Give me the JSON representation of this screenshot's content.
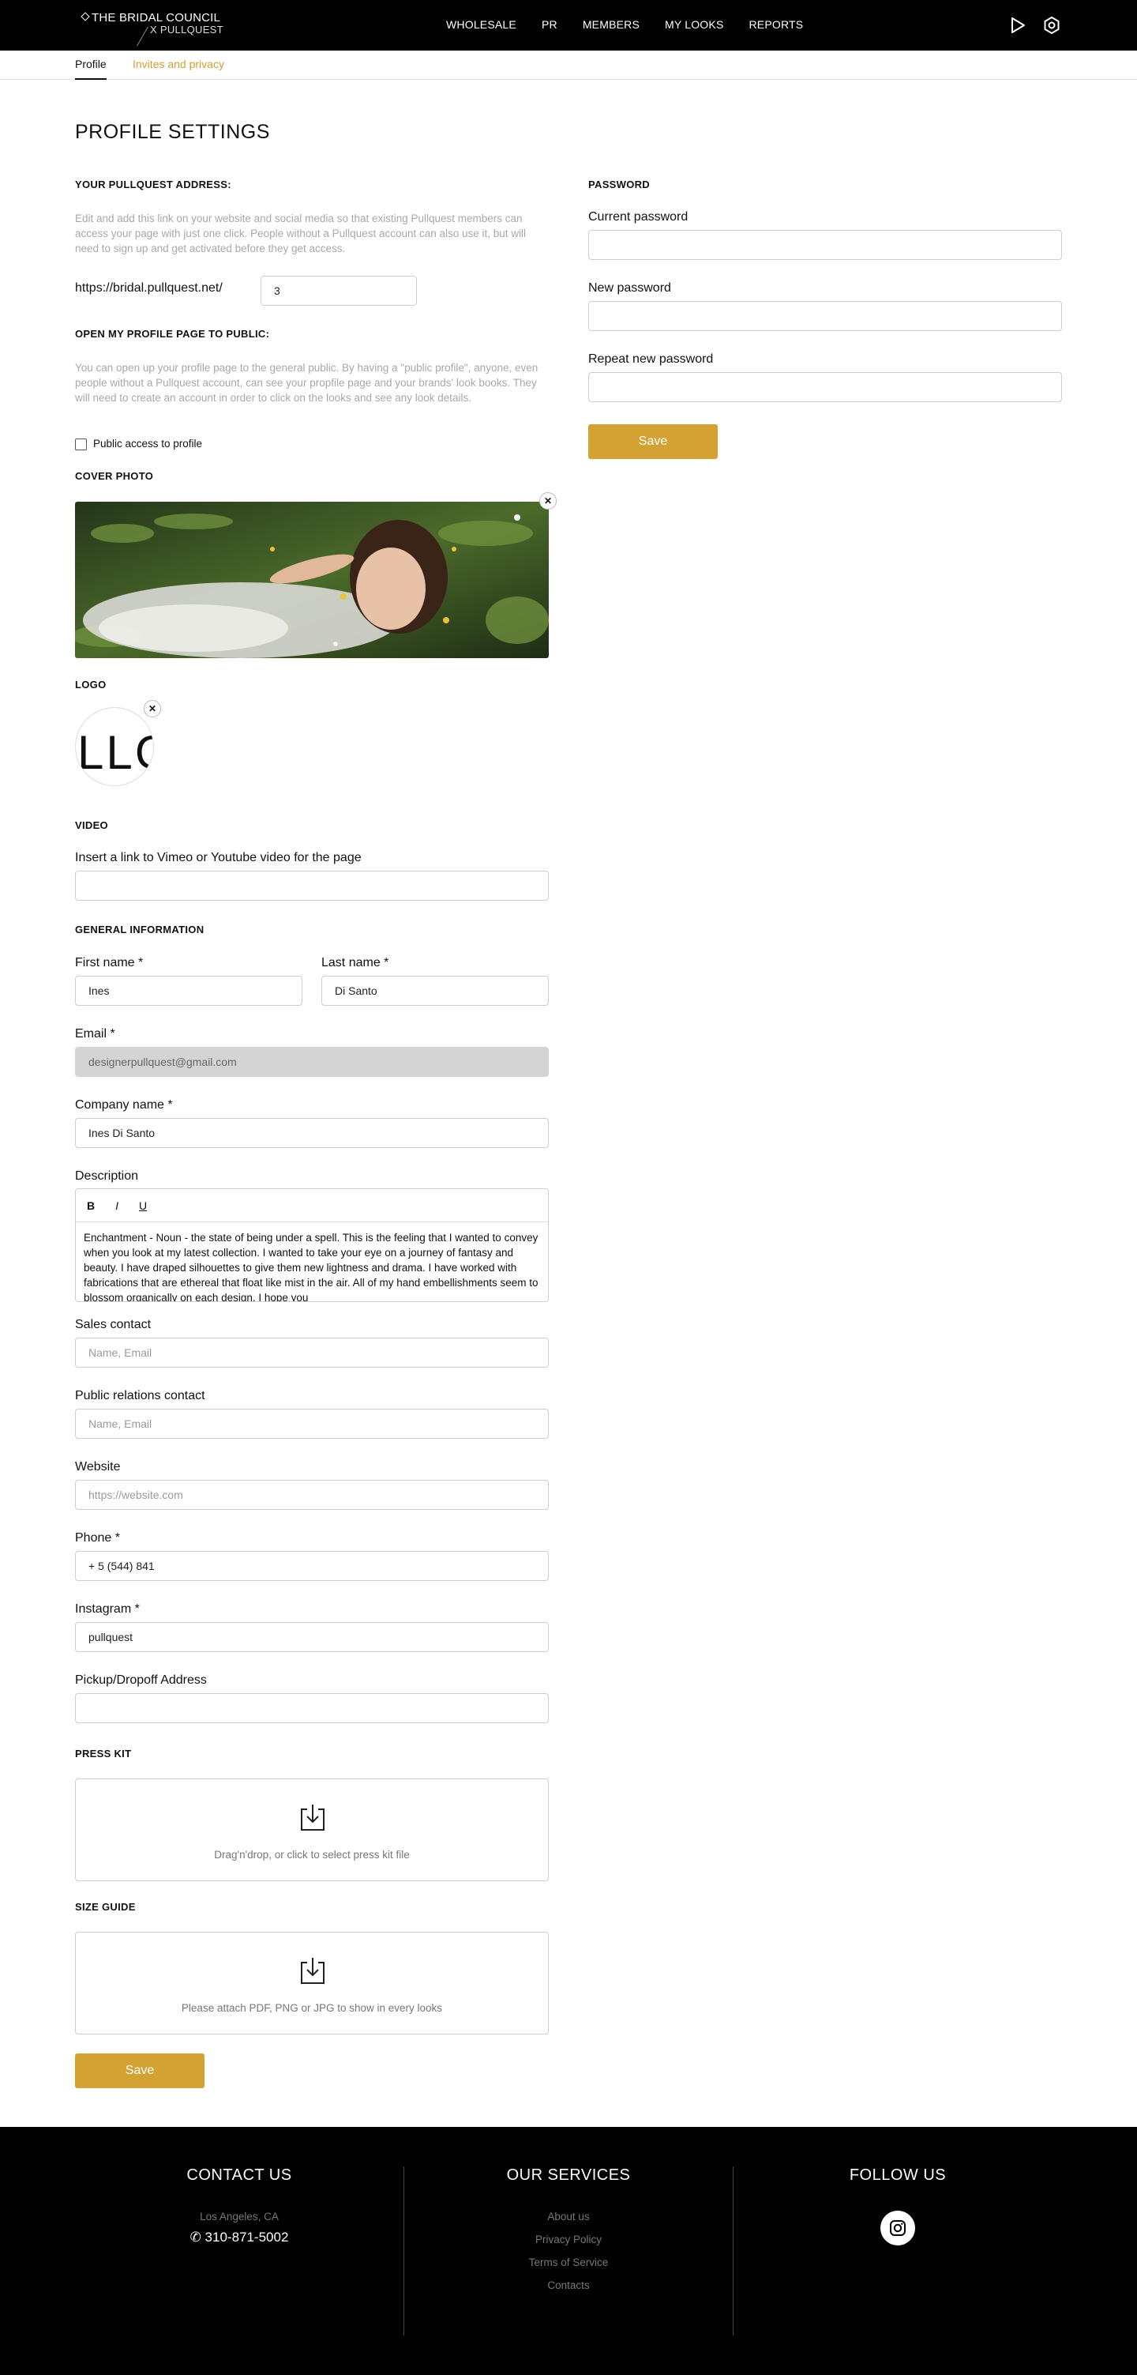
{
  "header": {
    "logo_line1": "THE BRIDAL COUNCIL",
    "logo_line2": "X PULLQUEST",
    "nav": [
      "WHOLESALE",
      "PR",
      "MEMBERS",
      "MY LOOKS",
      "REPORTS"
    ]
  },
  "tabs": {
    "active": "Profile",
    "other": "Invites and privacy"
  },
  "page_title": "PROFILE SETTINGS",
  "address": {
    "heading": "YOUR PULLQUEST ADDRESS:",
    "help": "Edit and add this link on your website and social media so that existing Pullquest members can access your page with just one click. People without a Pullquest account can also use it, but will need to sign up and get activated before they get access.",
    "prefix": "https://bridal.pullquest.net/",
    "value": "3"
  },
  "public": {
    "heading": "OPEN MY PROFILE PAGE TO PUBLIC:",
    "help": "You can open up your profile page to the general public. By having a \"public profile\", anyone, even people without a Pullquest account, can see your propfile page and your brands' look books. They will need to create an account in order to click on the looks and see any look details.",
    "checkbox_label": "Public access to profile",
    "checked": false
  },
  "cover": {
    "heading": "COVER PHOTO"
  },
  "logo_section": {
    "heading": "LOGO",
    "logo_text": "LLG"
  },
  "video": {
    "heading": "VIDEO",
    "label": "Insert a link to Vimeo or Youtube video for the page",
    "value": ""
  },
  "general": {
    "heading": "GENERAL INFORMATION",
    "first_name_label": "First name *",
    "first_name": "Ines",
    "last_name_label": "Last name *",
    "last_name": "Di Santo",
    "email_label": "Email *",
    "email": "designerpullquest@gmail.com",
    "company_label": "Company name *",
    "company": "Ines Di Santo",
    "description_label": "Description",
    "toolbar": [
      "B",
      "I",
      "U"
    ],
    "description": "Enchantment - Noun - the state of being under a spell. This is the feeling that I wanted to convey when you look at my latest collection. I wanted to take your eye on a journey of fantasy and beauty. I have draped silhouettes to give them new lightness and drama. I have worked with fabrications that are ethereal that float like mist in the air. All of my hand embellishments seem to blossom organically on each design. I hope you",
    "sales_label": "Sales contact",
    "sales_placeholder": "Name, Email",
    "pr_label": "Public relations contact",
    "pr_placeholder": "Name, Email",
    "website_label": "Website",
    "website_placeholder": "https://website.com",
    "phone_label": "Phone *",
    "phone": "+ 5 (544) 841",
    "instagram_label": "Instagram *",
    "instagram": "pullquest",
    "pickup_label": "Pickup/Dropoff Address",
    "pickup": ""
  },
  "press_kit": {
    "heading": "PRESS KIT",
    "text": "Drag'n'drop, or click to select press kit file"
  },
  "size_guide": {
    "heading": "SIZE GUIDE",
    "text": "Please attach PDF, PNG or JPG to show in every looks"
  },
  "save_label": "Save",
  "password": {
    "heading": "PASSWORD",
    "current_label": "Current password",
    "new_label": "New password",
    "repeat_label": "Repeat new password",
    "save_label": "Save"
  },
  "footer": {
    "contact_heading": "CONTACT US",
    "location": "Los Angeles, CA",
    "phone": "310-871-5002",
    "services_heading": "OUR SERVICES",
    "services": [
      "About us",
      "Privacy Policy",
      "Terms of Service",
      "Contacts"
    ],
    "follow_heading": "FOLLOW US"
  },
  "colors": {
    "accent": "#d3a232",
    "tab_link": "#d0a030",
    "header_bg": "#000000"
  }
}
